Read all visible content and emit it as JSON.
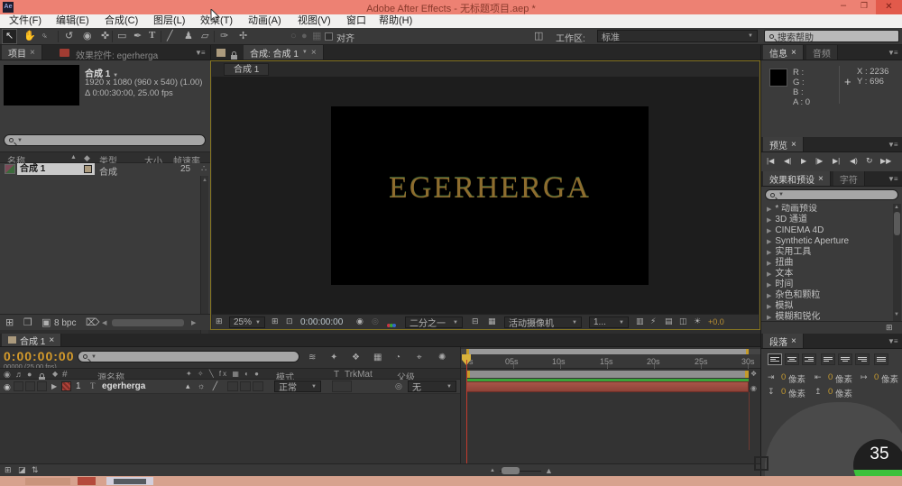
{
  "window": {
    "app_initials": "Ae",
    "title": "Adobe After Effects - 无标题项目.aep *",
    "minimize_glyph": "–",
    "maximize_glyph": "❐",
    "close_glyph": "✕"
  },
  "menu": {
    "items": [
      "文件(F)",
      "编辑(E)",
      "合成(C)",
      "图层(L)",
      "效果(T)",
      "动画(A)",
      "视图(V)",
      "窗口",
      "帮助(H)"
    ]
  },
  "toolbar": {
    "tools": [
      "↖",
      "✋",
      "♀",
      "↺",
      "◉",
      "✜",
      "▭",
      "✒",
      "T",
      "╱",
      "♟",
      "▱",
      "✑",
      "✢"
    ],
    "disabled_tools": [
      "○",
      "●",
      "▦"
    ],
    "snap_label": "对齐",
    "workspace_label": "工作区:",
    "workspace_value": "标准",
    "help_search": "搜索帮助"
  },
  "project": {
    "tab": "项目",
    "tab2": "效果控件: egerherga",
    "comp_name": "合成 1",
    "comp_line1": "1920 x 1080  (960 x 540) (1.00)",
    "comp_line2": "Δ 0:00:30:00, 25.00 fps",
    "col_name": "名称",
    "col_type": "类型",
    "col_size": "大小",
    "col_fps": "帧速率",
    "row_name": "合成 1",
    "row_type": "合成",
    "row_fps": "25",
    "bpc": "8 bpc"
  },
  "comp": {
    "tab_label": "合成: 合成 1",
    "viewer_tab": "合成 1",
    "canvas_text": "EGERHERGA",
    "zoom_value": "25%",
    "timecode": "0:00:00:00",
    "resolution": "二分之一",
    "camera": "活动摄像机",
    "views": "1...",
    "exposure": "+0.0"
  },
  "info": {
    "tab": "信息",
    "tab2": "音频",
    "r": "R :",
    "g": "G :",
    "b": "B :",
    "a": "A :  0",
    "x": "X : 2236",
    "y": "Y : 696"
  },
  "preview": {
    "tab": "预览",
    "buttons": [
      "|◀",
      "◀|",
      "▶",
      "|▶",
      "▶|",
      "◀)",
      "↻",
      "▶▶"
    ]
  },
  "effects": {
    "tab": "效果和预设",
    "tab2": "字符",
    "items": [
      "* 动画预设",
      "3D 通道",
      "CINEMA 4D",
      "Synthetic Aperture",
      "实用工具",
      "扭曲",
      "文本",
      "时间",
      "杂色和颗粒",
      "模拟",
      "模糊和锐化"
    ]
  },
  "paragraph": {
    "tab": "段落",
    "value": "0",
    "unit": "像素"
  },
  "timeline": {
    "tab": "合成 1",
    "timecode": "0:00:00:00",
    "timecode_sub": "00000 (25.00 fps)",
    "tool_icons": [
      "≋",
      "✦",
      "❖",
      "▦",
      "◔",
      "⌖",
      "✺"
    ],
    "col_source": "源名称",
    "col_mode": "模式",
    "col_t": "T",
    "col_trkmat": "TrkMat",
    "col_parent": "父级",
    "switches_header": "✦ ✧ ╲ fx ▦ ◐ ●",
    "layer_switches": "▴ ☼ ╱",
    "layer": {
      "index": "1",
      "name": "egerherga",
      "mode": "正常",
      "parent": "无"
    },
    "ticks": [
      "0s",
      "05s",
      "10s",
      "15s",
      "20s",
      "25s",
      "30s"
    ]
  },
  "overlay": {
    "badge": "35"
  },
  "icons": {
    "caret": "▼",
    "menu": "▼≡",
    "close": "×",
    "sort_asc": "▲",
    "tag": "◆",
    "up": "▲",
    "down": "▼",
    "left": "◀",
    "right": "▶",
    "tri": "▶",
    "pickwhip": "◎",
    "flowchart": "∴",
    "crosshair": "+",
    "eye": "◉",
    "audio": "♬",
    "solo": "●",
    "workspace": "◫",
    "grid": "⊞",
    "safe": "⊡",
    "snapshot": "◉",
    "snapshot_show": "◎",
    "roi": "⊟",
    "transp": "▦",
    "pixel_aspect": "▥",
    "fast": "⚡",
    "tl_btn": "▤",
    "flow_btn": "◫",
    "exposure_icon": "☀",
    "import": "⊞",
    "folder": "❒",
    "bpc_icon": "▣",
    "trash": "⌦",
    "mountain": "▲",
    "toggle1": "⊞",
    "toggle2": "◪",
    "toggle3": "⇅",
    "indent1": "⇥",
    "indent2": "⇤",
    "indent3": "↦",
    "indent4": "↧",
    "indent5": "↥",
    "shield": "❖",
    "camera2": "◉",
    "hash": "#"
  }
}
